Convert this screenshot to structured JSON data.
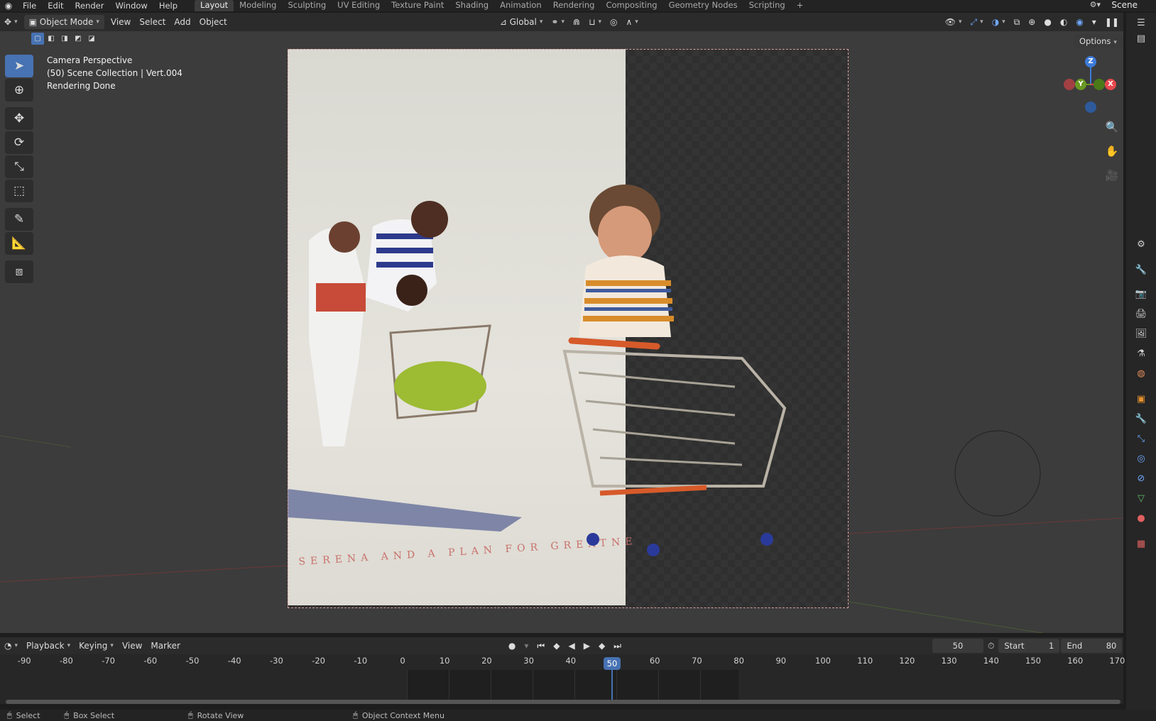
{
  "topbar": {
    "menus": [
      "File",
      "Edit",
      "Render",
      "Window",
      "Help"
    ],
    "workspaces": [
      "Layout",
      "Modeling",
      "Sculpting",
      "UV Editing",
      "Texture Paint",
      "Shading",
      "Animation",
      "Rendering",
      "Compositing",
      "Geometry Nodes",
      "Scripting"
    ],
    "active_workspace": "Layout",
    "add_tab": "+",
    "scene": "Scene"
  },
  "viewport_header": {
    "mode": "Object Mode",
    "menus": [
      "View",
      "Select",
      "Add",
      "Object"
    ],
    "orientation": "Global",
    "options": "Options"
  },
  "overlay": {
    "line1": "Camera Perspective",
    "line2": "(50) Scene Collection | Vert.004",
    "line3": "Rendering Done"
  },
  "poster": {
    "caption": "SERENA AND A PLAN FOR GREATNE"
  },
  "gizmo": {
    "x": "X",
    "y": "Y",
    "z": "Z"
  },
  "timeline": {
    "menus": [
      "Playback",
      "Keying",
      "View",
      "Marker"
    ],
    "current_frame": "50",
    "start_label": "Start",
    "start_value": "1",
    "end_label": "End",
    "end_value": "80",
    "ticks": [
      "-90",
      "-80",
      "-70",
      "-60",
      "-50",
      "-40",
      "-30",
      "-20",
      "-10",
      "0",
      "10",
      "20",
      "30",
      "40",
      "50",
      "60",
      "70",
      "80",
      "90",
      "100",
      "110",
      "120",
      "130",
      "140",
      "150",
      "160",
      "170"
    ],
    "playhead": "50"
  },
  "statusbar": {
    "select": "Select",
    "box_select": "Box Select",
    "rotate_view": "Rotate View",
    "context_menu": "Object Context Menu"
  },
  "colors": {
    "accent": "#4772b3",
    "x_axis": "#e5484d",
    "y_axis": "#6a9a23",
    "z_axis": "#3d7bd9"
  }
}
